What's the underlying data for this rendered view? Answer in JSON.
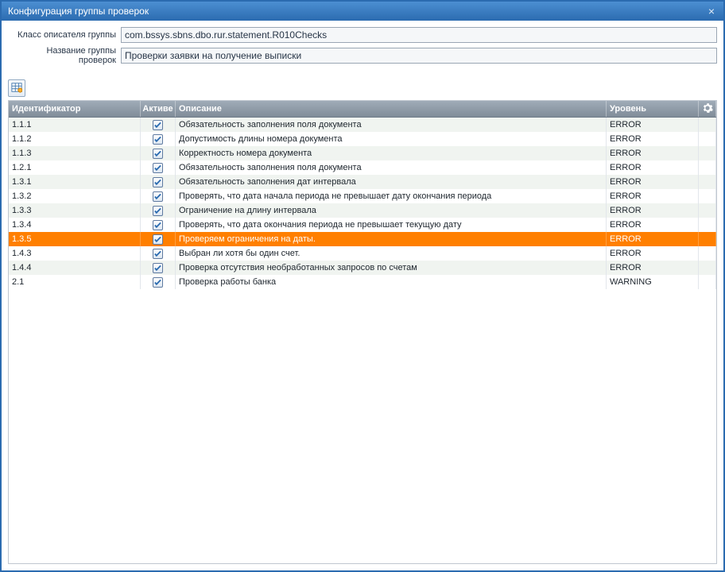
{
  "window": {
    "title": "Конфигурация группы проверок"
  },
  "form": {
    "class_label": "Класс описателя группы",
    "class_value": "com.bssys.sbns.dbo.rur.statement.R010Checks",
    "name_label": "Название группы проверок",
    "name_value": "Проверки заявки на получение выписки"
  },
  "grid": {
    "headers": {
      "id": "Идентификатор",
      "active": "Активе",
      "desc": "Описание",
      "level": "Уровень"
    },
    "rows": [
      {
        "id": "1.1.1",
        "active": true,
        "desc": "Обязательность заполнения поля документа",
        "level": "ERROR",
        "selected": false
      },
      {
        "id": "1.1.2",
        "active": true,
        "desc": "Допустимость длины номера документа",
        "level": "ERROR",
        "selected": false
      },
      {
        "id": "1.1.3",
        "active": true,
        "desc": "Корректность номера документа",
        "level": "ERROR",
        "selected": false
      },
      {
        "id": "1.2.1",
        "active": true,
        "desc": "Обязательность заполнения поля документа",
        "level": "ERROR",
        "selected": false
      },
      {
        "id": "1.3.1",
        "active": true,
        "desc": "Обязательность заполнения дат интервала",
        "level": "ERROR",
        "selected": false
      },
      {
        "id": "1.3.2",
        "active": true,
        "desc": "Проверять, что дата начала периода не превышает дату окончания периода",
        "level": "ERROR",
        "selected": false
      },
      {
        "id": "1.3.3",
        "active": true,
        "desc": "Ограничение на длину интервала",
        "level": "ERROR",
        "selected": false
      },
      {
        "id": "1.3.4",
        "active": true,
        "desc": "Проверять, что дата окончания периода не превышает текущую дату",
        "level": "ERROR",
        "selected": false
      },
      {
        "id": "1.3.5",
        "active": true,
        "desc": "Проверяем ограничения на даты.",
        "level": "ERROR",
        "selected": true
      },
      {
        "id": "1.4.3",
        "active": true,
        "desc": "Выбран ли хотя бы один счет.",
        "level": "ERROR",
        "selected": false
      },
      {
        "id": "1.4.4",
        "active": true,
        "desc": "Проверка отсутствия необработанных запросов по счетам",
        "level": "ERROR",
        "selected": false
      },
      {
        "id": "2.1",
        "active": true,
        "desc": "Проверка работы банка",
        "level": "WARNING",
        "selected": false
      }
    ]
  }
}
